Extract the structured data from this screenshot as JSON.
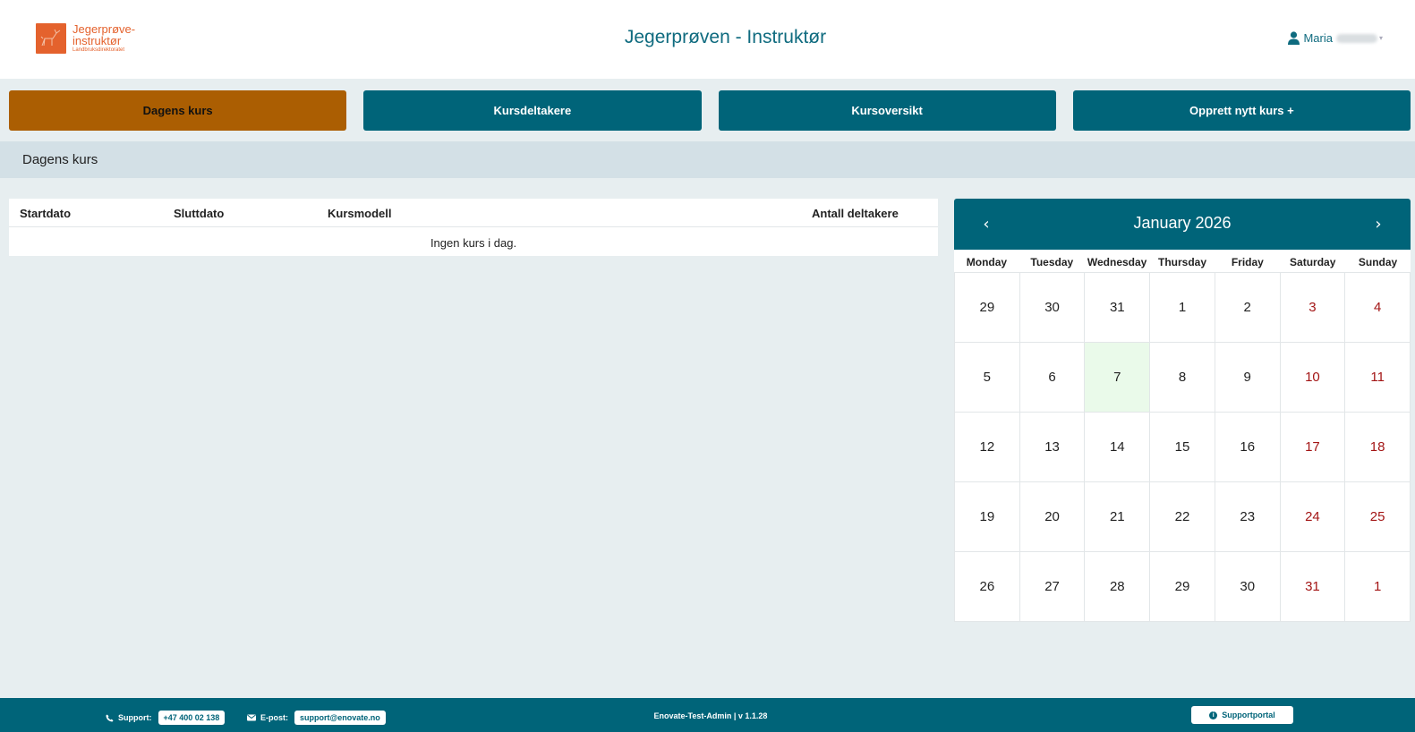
{
  "header": {
    "logo_line1": "Jegerprøve-",
    "logo_line2": "instruktør",
    "logo_line3": "Landbruksdirektoratet",
    "title": "Jegerprøven - Instruktør",
    "user_name": "Maria"
  },
  "nav": {
    "items": [
      {
        "label": "Dagens kurs",
        "active": true
      },
      {
        "label": "Kursdeltakere",
        "active": false
      },
      {
        "label": "Kursoversikt",
        "active": false
      },
      {
        "label": "Opprett nytt kurs +",
        "active": false
      }
    ]
  },
  "section": {
    "title": "Dagens kurs"
  },
  "table": {
    "columns": [
      "Startdato",
      "Sluttdato",
      "Kursmodell",
      "Antall deltakere"
    ],
    "empty_message": "Ingen kurs i dag."
  },
  "calendar": {
    "month_label": "January 2026",
    "prev_icon": "chevron-left-icon",
    "next_icon": "chevron-right-icon",
    "weekdays": [
      "Monday",
      "Tuesday",
      "Wednesday",
      "Thursday",
      "Friday",
      "Saturday",
      "Sunday"
    ],
    "weeks": [
      [
        "29",
        "30",
        "31",
        "1",
        "2",
        "3",
        "4"
      ],
      [
        "5",
        "6",
        "7",
        "8",
        "9",
        "10",
        "11"
      ],
      [
        "12",
        "13",
        "14",
        "15",
        "16",
        "17",
        "18"
      ],
      [
        "19",
        "20",
        "21",
        "22",
        "23",
        "24",
        "25"
      ],
      [
        "26",
        "27",
        "28",
        "29",
        "30",
        "31",
        "1"
      ]
    ],
    "today": "7",
    "today_color": "#eafaea",
    "weekend_color": "#a31515"
  },
  "footer": {
    "support_label": "Support:",
    "support_phone": "+47 400 02 138",
    "email_label": "E-post:",
    "email": "support@enovate.no",
    "version": "Enovate-Test-Admin | v 1.1.28",
    "portal_label": "Supportportal"
  },
  "colors": {
    "primary": "#006479",
    "active_tab": "#ab5e02",
    "logo": "#e4622d",
    "background": "#e7eef0",
    "section_bar": "#d3e0e6"
  }
}
